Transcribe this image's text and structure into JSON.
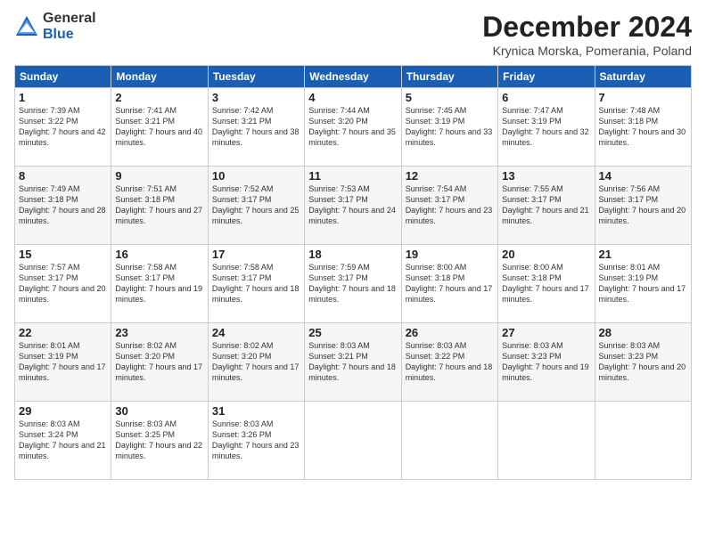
{
  "logo": {
    "general": "General",
    "blue": "Blue"
  },
  "title": {
    "month": "December 2024",
    "location": "Krynica Morska, Pomerania, Poland"
  },
  "days_of_week": [
    "Sunday",
    "Monday",
    "Tuesday",
    "Wednesday",
    "Thursday",
    "Friday",
    "Saturday"
  ],
  "weeks": [
    [
      {
        "day": "1",
        "sunrise": "Sunrise: 7:39 AM",
        "sunset": "Sunset: 3:22 PM",
        "daylight": "Daylight: 7 hours and 42 minutes."
      },
      {
        "day": "2",
        "sunrise": "Sunrise: 7:41 AM",
        "sunset": "Sunset: 3:21 PM",
        "daylight": "Daylight: 7 hours and 40 minutes."
      },
      {
        "day": "3",
        "sunrise": "Sunrise: 7:42 AM",
        "sunset": "Sunset: 3:21 PM",
        "daylight": "Daylight: 7 hours and 38 minutes."
      },
      {
        "day": "4",
        "sunrise": "Sunrise: 7:44 AM",
        "sunset": "Sunset: 3:20 PM",
        "daylight": "Daylight: 7 hours and 35 minutes."
      },
      {
        "day": "5",
        "sunrise": "Sunrise: 7:45 AM",
        "sunset": "Sunset: 3:19 PM",
        "daylight": "Daylight: 7 hours and 33 minutes."
      },
      {
        "day": "6",
        "sunrise": "Sunrise: 7:47 AM",
        "sunset": "Sunset: 3:19 PM",
        "daylight": "Daylight: 7 hours and 32 minutes."
      },
      {
        "day": "7",
        "sunrise": "Sunrise: 7:48 AM",
        "sunset": "Sunset: 3:18 PM",
        "daylight": "Daylight: 7 hours and 30 minutes."
      }
    ],
    [
      {
        "day": "8",
        "sunrise": "Sunrise: 7:49 AM",
        "sunset": "Sunset: 3:18 PM",
        "daylight": "Daylight: 7 hours and 28 minutes."
      },
      {
        "day": "9",
        "sunrise": "Sunrise: 7:51 AM",
        "sunset": "Sunset: 3:18 PM",
        "daylight": "Daylight: 7 hours and 27 minutes."
      },
      {
        "day": "10",
        "sunrise": "Sunrise: 7:52 AM",
        "sunset": "Sunset: 3:17 PM",
        "daylight": "Daylight: 7 hours and 25 minutes."
      },
      {
        "day": "11",
        "sunrise": "Sunrise: 7:53 AM",
        "sunset": "Sunset: 3:17 PM",
        "daylight": "Daylight: 7 hours and 24 minutes."
      },
      {
        "day": "12",
        "sunrise": "Sunrise: 7:54 AM",
        "sunset": "Sunset: 3:17 PM",
        "daylight": "Daylight: 7 hours and 23 minutes."
      },
      {
        "day": "13",
        "sunrise": "Sunrise: 7:55 AM",
        "sunset": "Sunset: 3:17 PM",
        "daylight": "Daylight: 7 hours and 21 minutes."
      },
      {
        "day": "14",
        "sunrise": "Sunrise: 7:56 AM",
        "sunset": "Sunset: 3:17 PM",
        "daylight": "Daylight: 7 hours and 20 minutes."
      }
    ],
    [
      {
        "day": "15",
        "sunrise": "Sunrise: 7:57 AM",
        "sunset": "Sunset: 3:17 PM",
        "daylight": "Daylight: 7 hours and 20 minutes."
      },
      {
        "day": "16",
        "sunrise": "Sunrise: 7:58 AM",
        "sunset": "Sunset: 3:17 PM",
        "daylight": "Daylight: 7 hours and 19 minutes."
      },
      {
        "day": "17",
        "sunrise": "Sunrise: 7:58 AM",
        "sunset": "Sunset: 3:17 PM",
        "daylight": "Daylight: 7 hours and 18 minutes."
      },
      {
        "day": "18",
        "sunrise": "Sunrise: 7:59 AM",
        "sunset": "Sunset: 3:17 PM",
        "daylight": "Daylight: 7 hours and 18 minutes."
      },
      {
        "day": "19",
        "sunrise": "Sunrise: 8:00 AM",
        "sunset": "Sunset: 3:18 PM",
        "daylight": "Daylight: 7 hours and 17 minutes."
      },
      {
        "day": "20",
        "sunrise": "Sunrise: 8:00 AM",
        "sunset": "Sunset: 3:18 PM",
        "daylight": "Daylight: 7 hours and 17 minutes."
      },
      {
        "day": "21",
        "sunrise": "Sunrise: 8:01 AM",
        "sunset": "Sunset: 3:19 PM",
        "daylight": "Daylight: 7 hours and 17 minutes."
      }
    ],
    [
      {
        "day": "22",
        "sunrise": "Sunrise: 8:01 AM",
        "sunset": "Sunset: 3:19 PM",
        "daylight": "Daylight: 7 hours and 17 minutes."
      },
      {
        "day": "23",
        "sunrise": "Sunrise: 8:02 AM",
        "sunset": "Sunset: 3:20 PM",
        "daylight": "Daylight: 7 hours and 17 minutes."
      },
      {
        "day": "24",
        "sunrise": "Sunrise: 8:02 AM",
        "sunset": "Sunset: 3:20 PM",
        "daylight": "Daylight: 7 hours and 17 minutes."
      },
      {
        "day": "25",
        "sunrise": "Sunrise: 8:03 AM",
        "sunset": "Sunset: 3:21 PM",
        "daylight": "Daylight: 7 hours and 18 minutes."
      },
      {
        "day": "26",
        "sunrise": "Sunrise: 8:03 AM",
        "sunset": "Sunset: 3:22 PM",
        "daylight": "Daylight: 7 hours and 18 minutes."
      },
      {
        "day": "27",
        "sunrise": "Sunrise: 8:03 AM",
        "sunset": "Sunset: 3:23 PM",
        "daylight": "Daylight: 7 hours and 19 minutes."
      },
      {
        "day": "28",
        "sunrise": "Sunrise: 8:03 AM",
        "sunset": "Sunset: 3:23 PM",
        "daylight": "Daylight: 7 hours and 20 minutes."
      }
    ],
    [
      {
        "day": "29",
        "sunrise": "Sunrise: 8:03 AM",
        "sunset": "Sunset: 3:24 PM",
        "daylight": "Daylight: 7 hours and 21 minutes."
      },
      {
        "day": "30",
        "sunrise": "Sunrise: 8:03 AM",
        "sunset": "Sunset: 3:25 PM",
        "daylight": "Daylight: 7 hours and 22 minutes."
      },
      {
        "day": "31",
        "sunrise": "Sunrise: 8:03 AM",
        "sunset": "Sunset: 3:26 PM",
        "daylight": "Daylight: 7 hours and 23 minutes."
      },
      null,
      null,
      null,
      null
    ]
  ]
}
